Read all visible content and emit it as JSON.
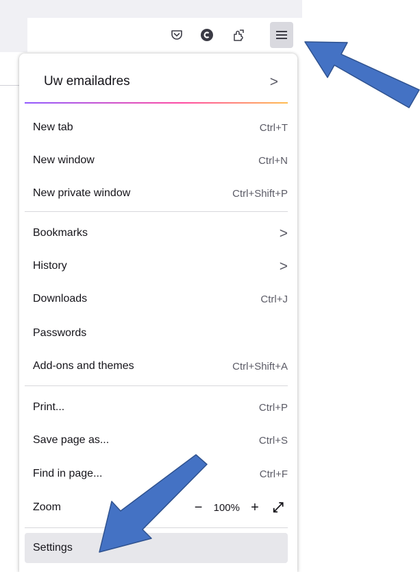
{
  "toolbar": {
    "icons": [
      "pocket-icon",
      "account-icon",
      "extensions-icon",
      "menu-icon"
    ]
  },
  "menu": {
    "account": {
      "label": "Uw emailadres",
      "chevron": ">"
    },
    "groups": [
      [
        {
          "label": "New tab",
          "shortcut": "Ctrl+T"
        },
        {
          "label": "New window",
          "shortcut": "Ctrl+N"
        },
        {
          "label": "New private window",
          "shortcut": "Ctrl+Shift+P"
        }
      ],
      [
        {
          "label": "Bookmarks",
          "chevron": ">"
        },
        {
          "label": "History",
          "chevron": ">"
        },
        {
          "label": "Downloads",
          "shortcut": "Ctrl+J"
        },
        {
          "label": "Passwords"
        },
        {
          "label": "Add-ons and themes",
          "shortcut": "Ctrl+Shift+A"
        }
      ],
      [
        {
          "label": "Print...",
          "shortcut": "Ctrl+P"
        },
        {
          "label": "Save page as...",
          "shortcut": "Ctrl+S"
        },
        {
          "label": "Find in page...",
          "shortcut": "Ctrl+F"
        }
      ]
    ],
    "zoom": {
      "label": "Zoom",
      "minus": "−",
      "value": "100%",
      "plus": "+",
      "fullscreen": "⤢"
    },
    "settings": {
      "label": "Settings"
    }
  },
  "annotations": {
    "arrow_color": "#4472c4"
  }
}
